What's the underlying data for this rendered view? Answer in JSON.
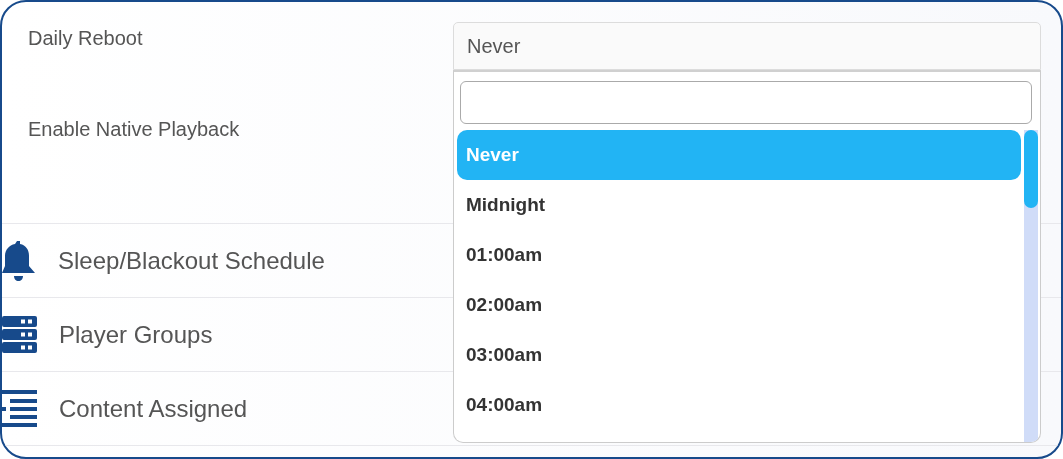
{
  "settings": [
    {
      "label": "Daily Reboot"
    },
    {
      "label": "Enable Native Playback"
    }
  ],
  "sections": [
    {
      "kind": "bell",
      "label": "Sleep/Blackout Schedule"
    },
    {
      "kind": "server",
      "label": "Player Groups"
    },
    {
      "kind": "list",
      "label": "Content Assigned"
    }
  ],
  "reboot_select": {
    "value": "Never",
    "expanded": true,
    "options": [
      {
        "label": "Never",
        "selected": true
      },
      {
        "label": "Midnight",
        "selected": false
      },
      {
        "label": "01:00am",
        "selected": false
      },
      {
        "label": "02:00am",
        "selected": false
      },
      {
        "label": "03:00am",
        "selected": false
      },
      {
        "label": "04:00am",
        "selected": false
      }
    ]
  }
}
